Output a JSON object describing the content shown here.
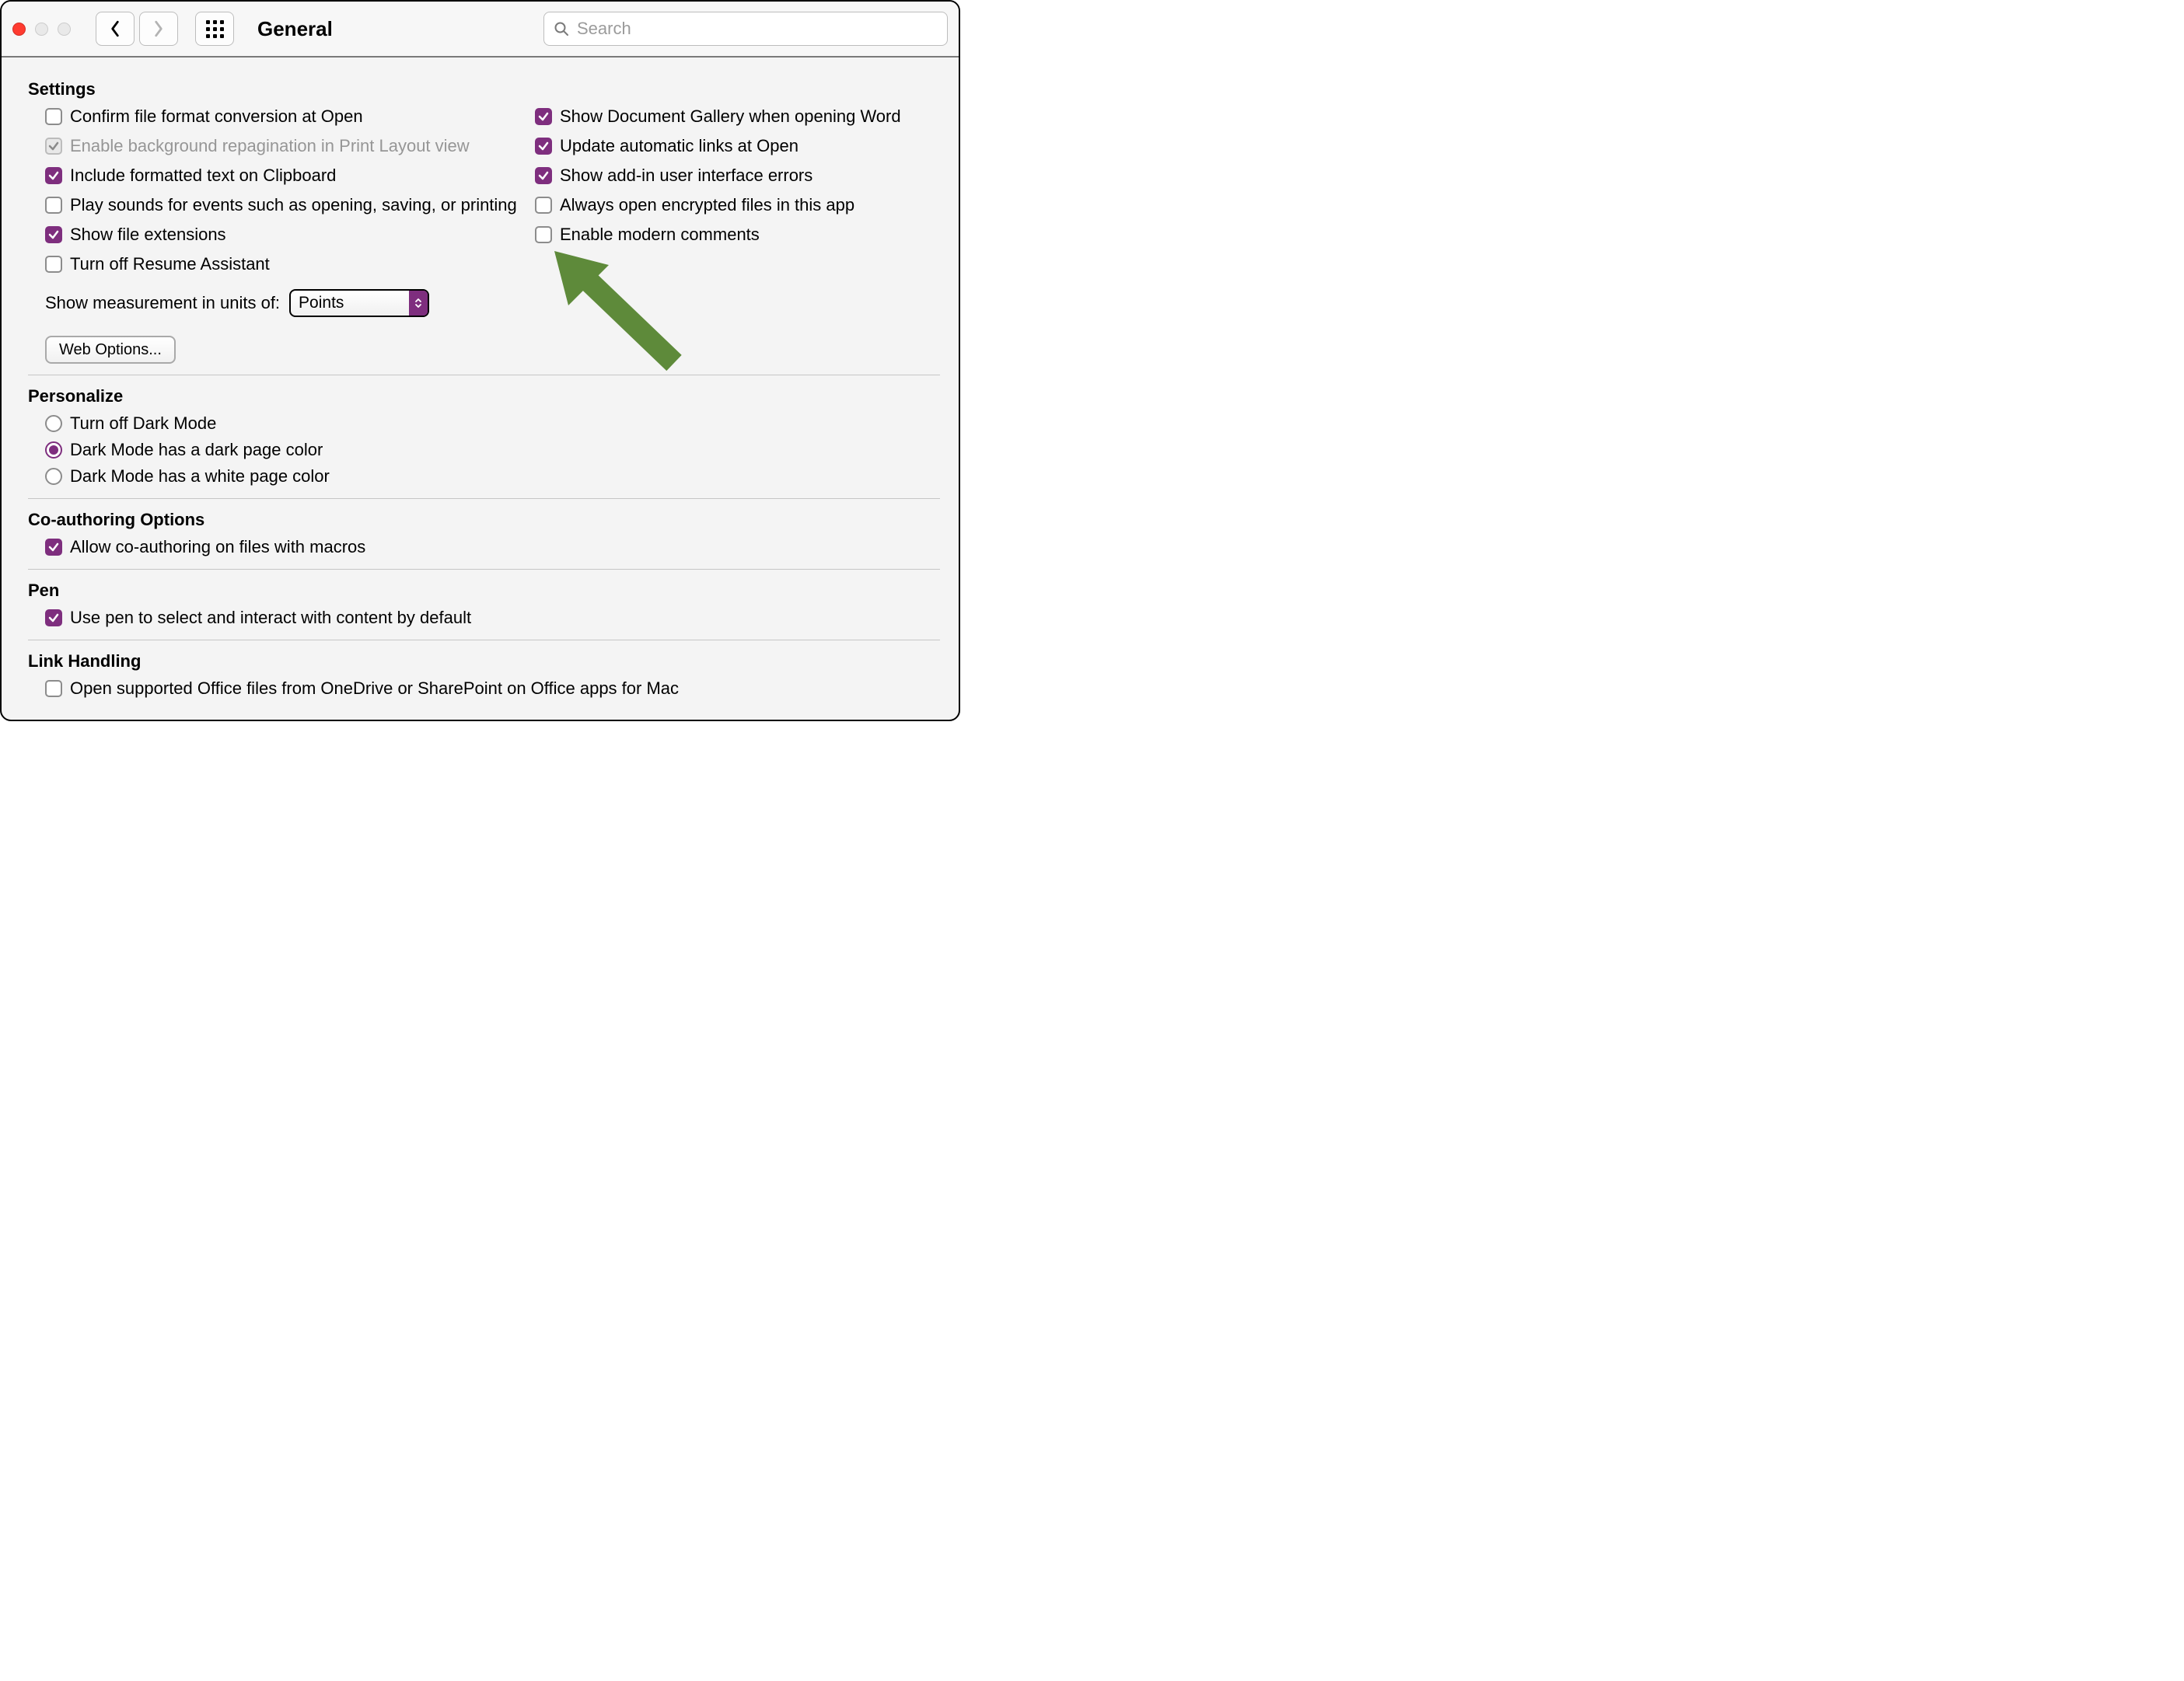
{
  "colors": {
    "accent": "#7e2e7e",
    "arrow": "#5e8a3a"
  },
  "titlebar": {
    "title": "General",
    "search_placeholder": "Search"
  },
  "sections": {
    "settings": {
      "title": "Settings",
      "left": [
        {
          "label": "Confirm file format conversion at Open",
          "checked": false,
          "disabled": false
        },
        {
          "label": "Enable background repagination in Print Layout view",
          "checked": true,
          "disabled": true
        },
        {
          "label": "Include formatted text on Clipboard",
          "checked": true,
          "disabled": false
        },
        {
          "label": "Play sounds for events such as opening, saving, or printing",
          "checked": false,
          "disabled": false
        },
        {
          "label": "Show file extensions",
          "checked": true,
          "disabled": false
        },
        {
          "label": "Turn off Resume Assistant",
          "checked": false,
          "disabled": false
        }
      ],
      "right": [
        {
          "label": "Show Document Gallery when opening Word",
          "checked": true
        },
        {
          "label": "Update automatic links at Open",
          "checked": true
        },
        {
          "label": "Show add-in user interface errors",
          "checked": true
        },
        {
          "label": "Always open encrypted files in this app",
          "checked": false
        },
        {
          "label": "Enable modern comments",
          "checked": false
        }
      ],
      "measure_label": "Show measurement in units of:",
      "measure_value": "Points",
      "web_options": "Web Options..."
    },
    "personalize": {
      "title": "Personalize",
      "options": [
        {
          "label": "Turn off Dark Mode",
          "selected": false
        },
        {
          "label": "Dark Mode has a dark page color",
          "selected": true
        },
        {
          "label": "Dark Mode has a white page color",
          "selected": false
        }
      ]
    },
    "coauthoring": {
      "title": "Co-authoring Options",
      "options": [
        {
          "label": "Allow co-authoring on files with macros",
          "checked": true
        }
      ]
    },
    "pen": {
      "title": "Pen",
      "options": [
        {
          "label": "Use pen to select and interact with content by default",
          "checked": true
        }
      ]
    },
    "link": {
      "title": "Link Handling",
      "options": [
        {
          "label": "Open supported Office files from OneDrive or SharePoint on Office apps for Mac",
          "checked": false
        }
      ]
    }
  },
  "annotation": {
    "arrow_points_to": "Enable modern comments"
  }
}
